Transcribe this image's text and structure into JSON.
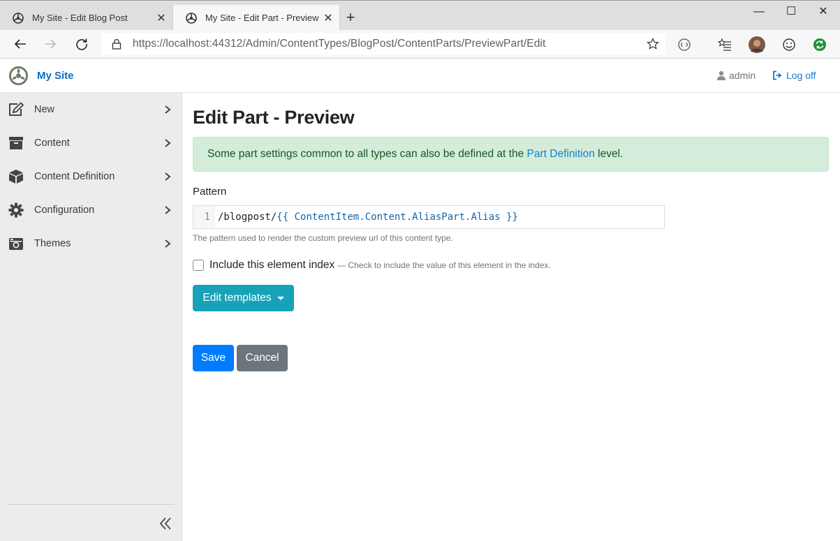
{
  "browser": {
    "tabs": [
      {
        "title": "My Site - Edit Blog Post",
        "active": false
      },
      {
        "title": "My Site - Edit Part - Preview",
        "active": true
      }
    ],
    "url": "https://localhost:44312/Admin/ContentTypes/BlogPost/ContentParts/PreviewPart/Edit"
  },
  "header": {
    "site_name": "My Site",
    "user": "admin",
    "logoff": "Log off"
  },
  "sidebar": {
    "items": [
      {
        "label": "New",
        "icon": "edit-icon"
      },
      {
        "label": "Content",
        "icon": "archive-icon"
      },
      {
        "label": "Content Definition",
        "icon": "cube-icon"
      },
      {
        "label": "Configuration",
        "icon": "cog-icon"
      },
      {
        "label": "Themes",
        "icon": "camera-retro-icon"
      }
    ]
  },
  "main": {
    "title": "Edit Part - Preview",
    "alert": {
      "prefix": "Some part settings common to all types can also be defined at the ",
      "link": "Part Definition",
      "suffix": " level."
    },
    "pattern": {
      "label": "Pattern",
      "line_number": "1",
      "code_plain": "/blogpost/",
      "code_liquid": "{{ ContentItem.Content.AliasPart.Alias }}",
      "hint": "The pattern used to render the custom preview url of this content type."
    },
    "index": {
      "label": "Include this element index",
      "hint": "— Check to include the value of this element in the index.",
      "checked": false
    },
    "edit_templates": "Edit templates",
    "save": "Save",
    "cancel": "Cancel"
  },
  "colors": {
    "brand_link": "#0a6ebd",
    "alert_bg": "#d4edda",
    "info_button": "#17a2b8",
    "primary_button": "#007bff",
    "secondary_button": "#6c757d"
  }
}
